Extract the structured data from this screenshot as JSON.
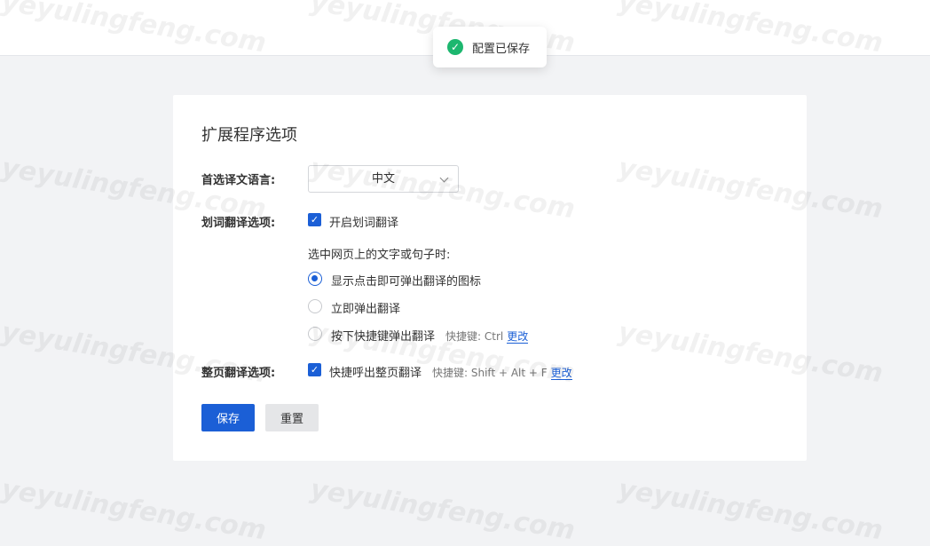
{
  "toast": {
    "message": "配置已保存"
  },
  "watermark": "yeyulingfeng.com",
  "options": {
    "title": "扩展程序选项",
    "language": {
      "label": "首选译文语言:",
      "value": "中文"
    },
    "word_translate": {
      "label": "划词翻译选项:",
      "enable_label": "开启划词翻译",
      "enabled": true,
      "prompt": "选中网页上的文字或句子时:",
      "modes": [
        {
          "label": "显示点击即可弹出翻译的图标",
          "selected": true
        },
        {
          "label": "立即弹出翻译",
          "selected": false
        },
        {
          "label": "按下快捷键弹出翻译",
          "selected": false,
          "hint": "快捷键: Ctrl",
          "link": "更改"
        }
      ]
    },
    "page_translate": {
      "label": "整页翻译选项:",
      "enable_label": "快捷呼出整页翻译",
      "enabled": true,
      "hint": "快捷键: Shift + Alt + F",
      "link": "更改"
    },
    "buttons": {
      "save": "保存",
      "reset": "重置"
    }
  },
  "colors": {
    "accent": "#1b5fd6",
    "success": "#1db76f",
    "background": "#f2f3f5"
  }
}
